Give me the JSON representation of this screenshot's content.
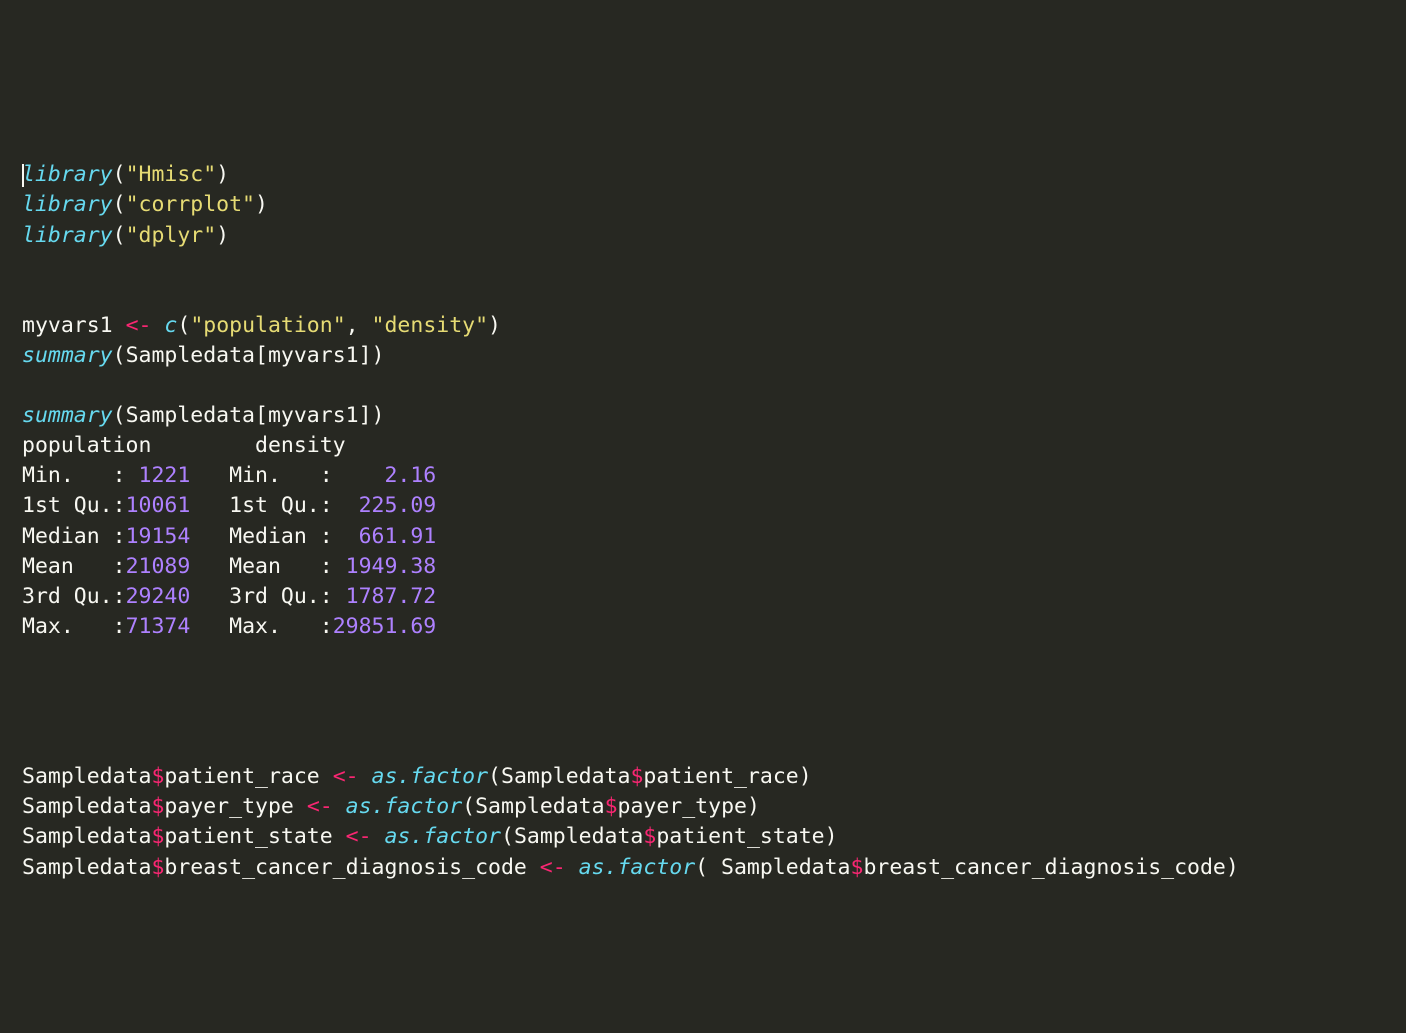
{
  "libs": {
    "fn": "library",
    "arg1": "\"Hmisc\"",
    "arg2": "\"corrplot\"",
    "arg3": "\"dplyr\""
  },
  "assign": {
    "lhs": "myvars1",
    "op": "<-",
    "cfn": "c",
    "a1": "\"population\"",
    "a2": "\"density\""
  },
  "sumcall": {
    "fn": "summary",
    "obj": "Sampledata",
    "idx": "myvars1"
  },
  "out": {
    "head": "population        density",
    "r1a": "Min.   :",
    "r1b": " 1221",
    "r1c": "   Min.   :",
    "r1d": "    2.16",
    "r2a": "1st Qu.:",
    "r2b": "10061",
    "r2c": "   1st Qu.:",
    "r2d": "  225.09",
    "r3a": "Median :",
    "r3b": "19154",
    "r3c": "   Median :",
    "r3d": "  661.91",
    "r4a": "Mean   :",
    "r4b": "21089",
    "r4c": "   Mean   :",
    "r4d": " 1949.38",
    "r5a": "3rd Qu.:",
    "r5b": "29240",
    "r5c": "   3rd Qu.:",
    "r5d": " 1787.72",
    "r6a": "Max.   :",
    "r6b": "71374",
    "r6c": "   Max.   :",
    "r6d": "29851.69"
  },
  "fac": {
    "obj": "Sampledata",
    "dollar": "$",
    "op": "<-",
    "fn": "as.factor",
    "f1": "patient_race",
    "f2": "payer_type",
    "f3": "patient_state",
    "f4": "breast_cancer_diagnosis_code"
  }
}
